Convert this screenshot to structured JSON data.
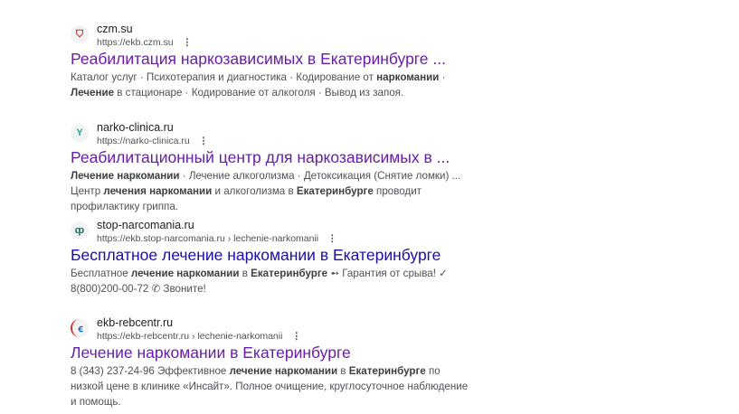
{
  "results": [
    {
      "site": "czm.su",
      "url": "https://ekb.czm.su",
      "title": "Реабилитация наркозависимых в Екатеринбурге ...",
      "visited": true,
      "favicon": "shield-icon",
      "snippet": [
        "Каталог услуг · Психотерапия и диагностика · Кодирование от ",
        "наркомании",
        " · ",
        "Лечение",
        " в стационаре · Кодирование от алкоголя · Вывод из запоя."
      ]
    },
    {
      "site": "narko-clinica.ru",
      "url": "https://narko-clinica.ru",
      "title": "Реабилитационный центр для наркозависимых в ...",
      "visited": true,
      "favicon": "sprout-icon",
      "snippet": [
        "Лечение наркомании",
        " · Лечение алкоголизма · Детоксикация (Снятие ломки) ... Центр ",
        "лечения наркомании",
        " и алкоголизма в ",
        "Екатеринбурге",
        " проводит профилактику гриппа."
      ]
    },
    {
      "site": "stop-narcomania.ru",
      "url": "https://ekb.stop-narcomania.ru › lechenie-narkomanii",
      "title": "Бесплатное лечение наркомании в Екатеринбурге",
      "visited": false,
      "favicon": "leaf-emblem-icon",
      "snippet": [
        "Бесплатное ",
        "лечение наркомании",
        " в ",
        "Екатеринбурге",
        " ➻ Гарантия от срыва! ✓ 8(800)200-00-72 ✆ Звоните!"
      ]
    },
    {
      "site": "ekb-rebcentr.ru",
      "url": "https://ekb-rebcentr.ru › lechenie-narkomanii",
      "title": "Лечение наркомании в Екатеринбурге",
      "visited": true,
      "favicon": "circle-logo-icon",
      "snippet": [
        "8 (343) 237-24-96 Эффективное ",
        "лечение наркомании",
        " в ",
        "Екатеринбурге",
        " по низкой цене в клинике «Инсайт». Полное очищение, круглосуточное наблюдение и помощь."
      ]
    }
  ],
  "more_label": "⋮"
}
